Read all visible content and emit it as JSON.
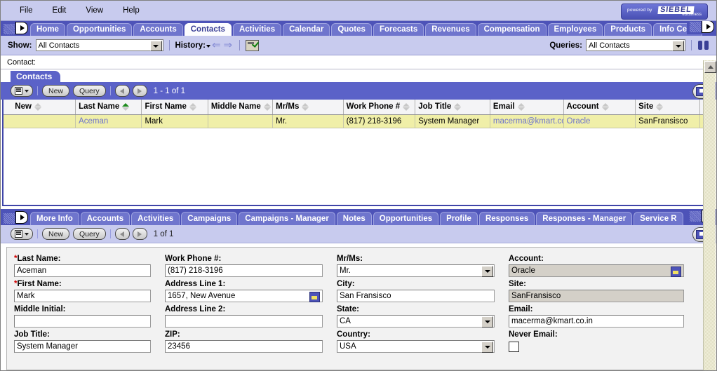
{
  "menu": {
    "items": [
      "File",
      "Edit",
      "View",
      "Help"
    ],
    "logo": {
      "powered_by": "powered by",
      "brand": "SIEBEL",
      "tagline": "eBusiness"
    }
  },
  "screen_tabs": {
    "items": [
      {
        "label": "Home",
        "active": false
      },
      {
        "label": "Opportunities",
        "active": false
      },
      {
        "label": "Accounts",
        "active": false
      },
      {
        "label": "Contacts",
        "active": true
      },
      {
        "label": "Activities",
        "active": false
      },
      {
        "label": "Calendar",
        "active": false
      },
      {
        "label": "Quotes",
        "active": false
      },
      {
        "label": "Forecasts",
        "active": false
      },
      {
        "label": "Revenues",
        "active": false
      },
      {
        "label": "Compensation",
        "active": false
      },
      {
        "label": "Employees",
        "active": false
      },
      {
        "label": "Products",
        "active": false
      },
      {
        "label": "Info Center",
        "active": false
      }
    ]
  },
  "toolbar": {
    "show_label": "Show:",
    "show_value": "All Contacts",
    "history_label": "History:",
    "queries_label": "Queries:",
    "queries_value": "All Contacts"
  },
  "contact_caption": "Contact:",
  "list_applet": {
    "title": "Contacts",
    "new_label": "New",
    "query_label": "Query",
    "counter": "1 - 1 of 1",
    "columns": [
      {
        "label": "New",
        "sorted": false
      },
      {
        "label": "Last Name",
        "sorted": true
      },
      {
        "label": "First Name",
        "sorted": false
      },
      {
        "label": "Middle Name",
        "sorted": false
      },
      {
        "label": "Mr/Ms",
        "sorted": false
      },
      {
        "label": "Work Phone #",
        "sorted": false
      },
      {
        "label": "Job Title",
        "sorted": false
      },
      {
        "label": "Email",
        "sorted": false
      },
      {
        "label": "Account",
        "sorted": false
      },
      {
        "label": "Site",
        "sorted": false
      }
    ],
    "rows": [
      {
        "new": "",
        "last_name": "Aceman",
        "first_name": "Mark",
        "middle_name": "",
        "mr_ms": "Mr.",
        "work_phone": "(817) 218-3196",
        "job_title": "System Manager",
        "email": "macerma@kmart.co",
        "account": "Oracle",
        "site": "SanFransisco"
      }
    ]
  },
  "view_tabs": {
    "items": [
      {
        "label": "More Info"
      },
      {
        "label": "Accounts"
      },
      {
        "label": "Activities"
      },
      {
        "label": "Campaigns"
      },
      {
        "label": "Campaigns - Manager"
      },
      {
        "label": "Notes"
      },
      {
        "label": "Opportunities"
      },
      {
        "label": "Profile"
      },
      {
        "label": "Responses"
      },
      {
        "label": "Responses - Manager"
      },
      {
        "label": "Service R"
      }
    ]
  },
  "form_applet": {
    "new_label": "New",
    "query_label": "Query",
    "counter": "1 of 1",
    "col1": [
      {
        "label": "Last Name:",
        "required": true,
        "value": "Aceman",
        "type": "text"
      },
      {
        "label": "First Name:",
        "required": true,
        "value": "Mark",
        "type": "text"
      },
      {
        "label": "Middle Initial:",
        "required": false,
        "value": "",
        "type": "text"
      },
      {
        "label": "Job Title:",
        "required": false,
        "value": "System Manager",
        "type": "text"
      }
    ],
    "col2": [
      {
        "label": "Work Phone #:",
        "required": false,
        "value": "(817) 218-3196",
        "type": "text"
      },
      {
        "label": "Address Line 1:",
        "required": false,
        "value": "1657, New Avenue",
        "type": "picker"
      },
      {
        "label": "Address Line 2:",
        "required": false,
        "value": "",
        "type": "text"
      },
      {
        "label": "ZIP:",
        "required": false,
        "value": "23456",
        "type": "text"
      }
    ],
    "col3": [
      {
        "label": "Mr/Ms:",
        "required": false,
        "value": "Mr.",
        "type": "select"
      },
      {
        "label": "City:",
        "required": false,
        "value": "San Fransisco",
        "type": "text"
      },
      {
        "label": "State:",
        "required": false,
        "value": "CA",
        "type": "select"
      },
      {
        "label": "Country:",
        "required": false,
        "value": "USA",
        "type": "select"
      }
    ],
    "col4": [
      {
        "label": "Account:",
        "required": false,
        "value": "Oracle",
        "type": "picker-ro"
      },
      {
        "label": "Site:",
        "required": false,
        "value": "SanFransisco",
        "type": "readonly"
      },
      {
        "label": "Email:",
        "required": false,
        "value": "macerma@kmart.co.in",
        "type": "text"
      },
      {
        "label": "Never Email:",
        "required": false,
        "value": "",
        "type": "checkbox"
      }
    ]
  },
  "colors": {
    "brand_purple": "#5B62C8",
    "tab_bar": "#4D53B8",
    "lavender": "#C8CBEE",
    "selected_row": "#F0EFA8",
    "link": "#6D74CC"
  }
}
